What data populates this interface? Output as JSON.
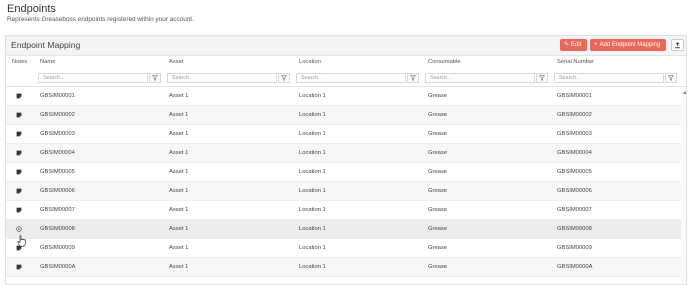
{
  "page": {
    "title": "Endpoints",
    "subtitle": "Represents Greaseboss endpoints registered within your account."
  },
  "panel": {
    "title": "Endpoint Mapping",
    "edit_label": "Edit",
    "add_label": "Add Endpoint Mapping",
    "export_icon": "export-icon"
  },
  "table": {
    "columns": [
      "Notes",
      "Name",
      "Asset",
      "Location",
      "Consumable",
      "Serial Number"
    ],
    "filter_placeholder": "Search...",
    "rows": [
      {
        "name": "GBSIM00001",
        "asset": "Asset 1",
        "location": "Location 1",
        "consumable": "Grease",
        "serial": "GBSIM00001"
      },
      {
        "name": "GBSIM00002",
        "asset": "Asset 1",
        "location": "Location 1",
        "consumable": "Grease",
        "serial": "GBSIM00002"
      },
      {
        "name": "GBSIM00003",
        "asset": "Asset 1",
        "location": "Location 1",
        "consumable": "Grease",
        "serial": "GBSIM00003"
      },
      {
        "name": "GBSIM00004",
        "asset": "Asset 1",
        "location": "Location 1",
        "consumable": "Grease",
        "serial": "GBSIM00004"
      },
      {
        "name": "GBSIM00005",
        "asset": "Asset 1",
        "location": "Location 1",
        "consumable": "Grease",
        "serial": "GBSIM00005"
      },
      {
        "name": "GBSIM00006",
        "asset": "Asset 1",
        "location": "Location 1",
        "consumable": "Grease",
        "serial": "GBSIM00006"
      },
      {
        "name": "GBSIM00007",
        "asset": "Asset 1",
        "location": "Location 1",
        "consumable": "Grease",
        "serial": "GBSIM00007"
      },
      {
        "name": "GBSIM00008",
        "asset": "Asset 1",
        "location": "Location 1",
        "consumable": "Grease",
        "serial": "GBSIM00008"
      },
      {
        "name": "GBSIM00009",
        "asset": "Asset 1",
        "location": "Location 1",
        "consumable": "Grease",
        "serial": "GBSIM00009"
      },
      {
        "name": "GBSIM0000A",
        "asset": "Asset 1",
        "location": "Location 1",
        "consumable": "Grease",
        "serial": "GBSIM0000A"
      }
    ]
  },
  "colors": {
    "accent": "#e8685b",
    "header_bg": "#f4f4f4",
    "alt_row": "#f7f7f7"
  }
}
